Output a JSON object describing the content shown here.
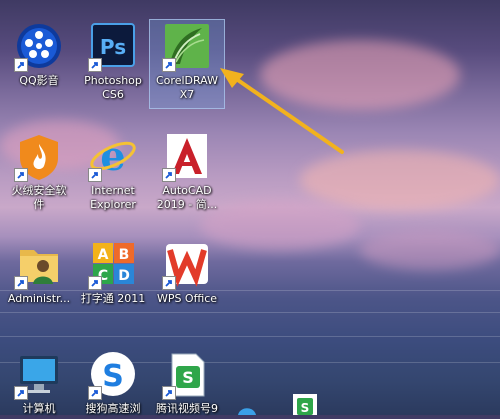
{
  "desktop": {
    "icons": [
      {
        "name": "qq-yingyin",
        "label": "QQ影音",
        "icon": "qq-player-icon"
      },
      {
        "name": "photoshop",
        "label": "Photoshop\nCS6",
        "icon": "photoshop-icon"
      },
      {
        "name": "coreldraw",
        "label": "CorelDRAW\nX7",
        "icon": "coreldraw-icon"
      },
      {
        "name": "huorong",
        "label": "火绒安全软\n件",
        "icon": "huorong-shield-icon"
      },
      {
        "name": "ie",
        "label": "Internet\nExplorer",
        "icon": "internet-explorer-icon"
      },
      {
        "name": "autocad",
        "label": "AutoCAD\n2019 - 简...",
        "icon": "autocad-icon"
      },
      {
        "name": "administrator",
        "label": "Administr...",
        "icon": "user-folder-icon"
      },
      {
        "name": "dazitong",
        "label": "打字通 2011",
        "icon": "abcd-blocks-icon"
      },
      {
        "name": "wps",
        "label": "WPS Office",
        "icon": "wps-office-icon"
      },
      {
        "name": "computer",
        "label": "计算机",
        "icon": "computer-icon"
      },
      {
        "name": "sogou",
        "label": "搜狗高速浏",
        "icon": "sogou-browser-icon"
      },
      {
        "name": "tencent-video",
        "label": "腾讯视频号9",
        "icon": "tencent-video-icon"
      }
    ],
    "accent_colors": {
      "selection": "#78a0dc",
      "arrow": "#f2b21e"
    }
  }
}
